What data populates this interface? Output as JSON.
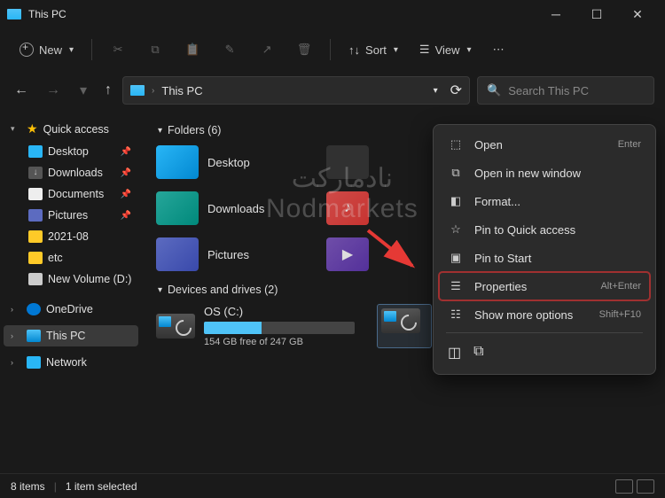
{
  "window": {
    "title": "This PC"
  },
  "toolbar": {
    "new": "New",
    "sort": "Sort",
    "view": "View"
  },
  "addressbar": {
    "location": "This PC",
    "refresh": "Refresh"
  },
  "search": {
    "placeholder": "Search This PC"
  },
  "sidebar": {
    "quick_access": "Quick access",
    "items": [
      {
        "label": "Desktop",
        "color": "#29b6f6",
        "pinned": true
      },
      {
        "label": "Downloads",
        "color": "#888",
        "pinned": true
      },
      {
        "label": "Documents",
        "color": "#eee",
        "pinned": true
      },
      {
        "label": "Pictures",
        "color": "#5c6bc0",
        "pinned": true
      },
      {
        "label": "2021-08",
        "color": "#ffca28",
        "pinned": false
      },
      {
        "label": "etc",
        "color": "#ffca28",
        "pinned": false
      },
      {
        "label": "New Volume (D:)",
        "color": "#ccc",
        "pinned": false
      }
    ],
    "onedrive": "OneDrive",
    "this_pc": "This PC",
    "network": "Network"
  },
  "content": {
    "folders_header": "Folders (6)",
    "folders": [
      {
        "label": "Desktop"
      },
      {
        "label": "Downloads"
      },
      {
        "label": "Pictures"
      }
    ],
    "drives_header": "Devices and drives (2)",
    "drives": [
      {
        "name": "OS (C:)",
        "free_text": "154 GB free of 247 GB",
        "fill_pct": 38
      },
      {
        "name": "",
        "free_text": "",
        "fill_pct": 0
      }
    ]
  },
  "context_menu": {
    "items": [
      {
        "icon": "open",
        "label": "Open",
        "shortcut": "Enter"
      },
      {
        "icon": "new-window",
        "label": "Open in new window",
        "shortcut": ""
      },
      {
        "icon": "format",
        "label": "Format...",
        "shortcut": ""
      },
      {
        "icon": "pin-qa",
        "label": "Pin to Quick access",
        "shortcut": ""
      },
      {
        "icon": "pin-start",
        "label": "Pin to Start",
        "shortcut": ""
      },
      {
        "icon": "properties",
        "label": "Properties",
        "shortcut": "Alt+Enter",
        "highlight": true
      },
      {
        "icon": "more",
        "label": "Show more options",
        "shortcut": "Shift+F10"
      }
    ]
  },
  "watermark": {
    "arabic": "نادمارکت",
    "latin": "Nodmarkets"
  },
  "statusbar": {
    "items": "8 items",
    "selected": "1 item selected"
  }
}
